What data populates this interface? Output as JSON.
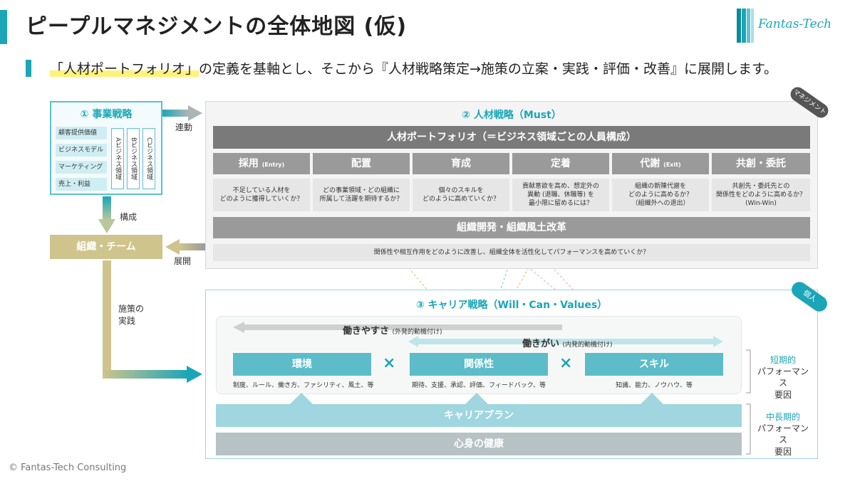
{
  "title": "ピープルマネジメントの全体地図 (仮)",
  "logo_text": "Fantas-Tech",
  "lead": {
    "highlight": "「人材ポートフォリオ」",
    "rest": "の定義を基軸とし、そこから『人材戦略策定→施策の立案・実践・評価・改善』に展開します。"
  },
  "business": {
    "title": "① 事業戦略",
    "items": [
      "顧客提供価値",
      "ビジネスモデル",
      "マーケティング",
      "売上・利益"
    ],
    "domains": [
      "Aビジネス領域",
      "Bビジネス領域",
      "Cビジネス領域"
    ]
  },
  "arrows": {
    "link": "連動",
    "compose": "構成",
    "deploy": "展開",
    "execute": "施策の\n実践"
  },
  "org": "組織・チーム",
  "must": {
    "title": "② 人材戦略（Must）",
    "tag": "マネジメント",
    "portfolio": "人材ポートフォリオ（＝ビジネス領域ごとの人員構成）",
    "functions": [
      {
        "label": "採用",
        "sub": "(Entry)",
        "question": "不足している人材を\nどのように獲得していくか？"
      },
      {
        "label": "配置",
        "sub": "",
        "question": "どの事業領域・どの組織に\n所属して活躍を期待するか？"
      },
      {
        "label": "育成",
        "sub": "",
        "question": "個々のスキルを\nどのように高めていくか？"
      },
      {
        "label": "定着",
        "sub": "",
        "question": "貢献意欲を高め、想定外の\n異動 (退職、休職等) を\n最小限に留めるには？"
      },
      {
        "label": "代謝",
        "sub": "(Exit)",
        "question": "組織の新陳代謝を\nどのように高めるか？\n（組織外への退出）"
      },
      {
        "label": "共創・委託",
        "sub": "",
        "question": "共創先・委託先との\n関係性をどのように高めるか？\n(Win-Win)"
      }
    ],
    "od": "組織開発・組織風土改革",
    "od_question": "関係性や相互作用をどのように改善し、組織全体を活性化してパフォーマンスを高めていくか？"
  },
  "career": {
    "title": "③ キャリア戦略（Will・Can・Values）",
    "tag": "個人",
    "ease": {
      "label": "働きやすさ",
      "sub": "(外発的動機付け)"
    },
    "worth": {
      "label": "働きがい",
      "sub": "(内発的動機付け)"
    },
    "factors": [
      {
        "label": "環境",
        "sub": "制度、ルール、働き方、ファシリティ、風土、等"
      },
      {
        "label": "関係性",
        "sub": "期待、支援、承認、評価、フィードバック、等"
      },
      {
        "label": "スキル",
        "sub": "知識、能力、ノウハウ、等"
      }
    ],
    "times": "×",
    "career_plan": "キャリアプラン",
    "health": "心身の健康",
    "short_term": {
      "accent": "短期的",
      "rest": "パフォーマンス\n要因"
    },
    "long_term": {
      "accent": "中長期的",
      "rest": "パフォーマンス\n要因"
    }
  },
  "footer": "© Fantas-Tech Consulting",
  "colors": {
    "accent": "#1aa6b7",
    "olive": "#cec48c",
    "dark_gray": "#7a7a7a",
    "mid_gray": "#9a9a9a"
  }
}
